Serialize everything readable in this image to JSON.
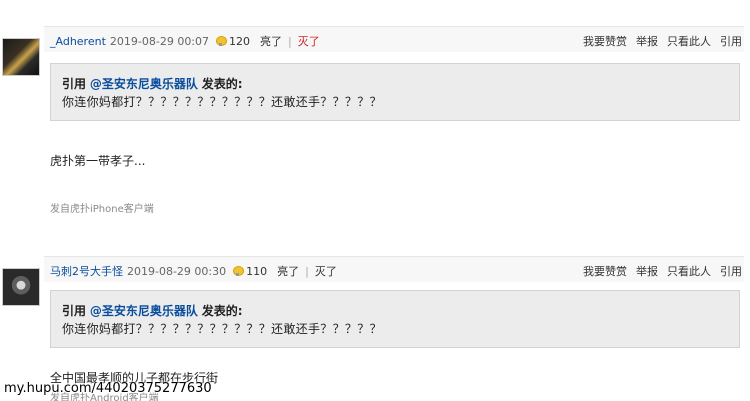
{
  "posts": [
    {
      "username": "_Adherent",
      "timestamp": "2019-08-29 00:07",
      "light_count": "120",
      "light_label": "亮了",
      "unlight_label": "灭了",
      "actions": [
        "我要赞赏",
        "举报",
        "只看此人",
        "引用"
      ],
      "quote_prefix": "引用",
      "quote_user": "@圣安东尼奥乐器队",
      "quote_suffix": "发表的:",
      "quote_text": "你连你妈都打？？？？？？？？？？？还敢还手？？？？？",
      "reply": "虎扑第一带孝子...",
      "client": "发自虎扑iPhone客户端"
    },
    {
      "username": "马刺2号大手怪",
      "timestamp": "2019-08-29 00:30",
      "light_count": "110",
      "light_label": "亮了",
      "unlight_label": "灭了",
      "actions": [
        "我要赞赏",
        "举报",
        "只看此人",
        "引用"
      ],
      "quote_prefix": "引用",
      "quote_user": "@圣安东尼奥乐器队",
      "quote_suffix": "发表的:",
      "quote_text": "你连你妈都打？？？？？？？？？？？还敢还手？？？？？",
      "reply": "全中国最孝顺的儿子都在步行街",
      "client": "发自虎扑Android客户端"
    }
  ],
  "watermark": "my.hupu.com/44020375277630"
}
